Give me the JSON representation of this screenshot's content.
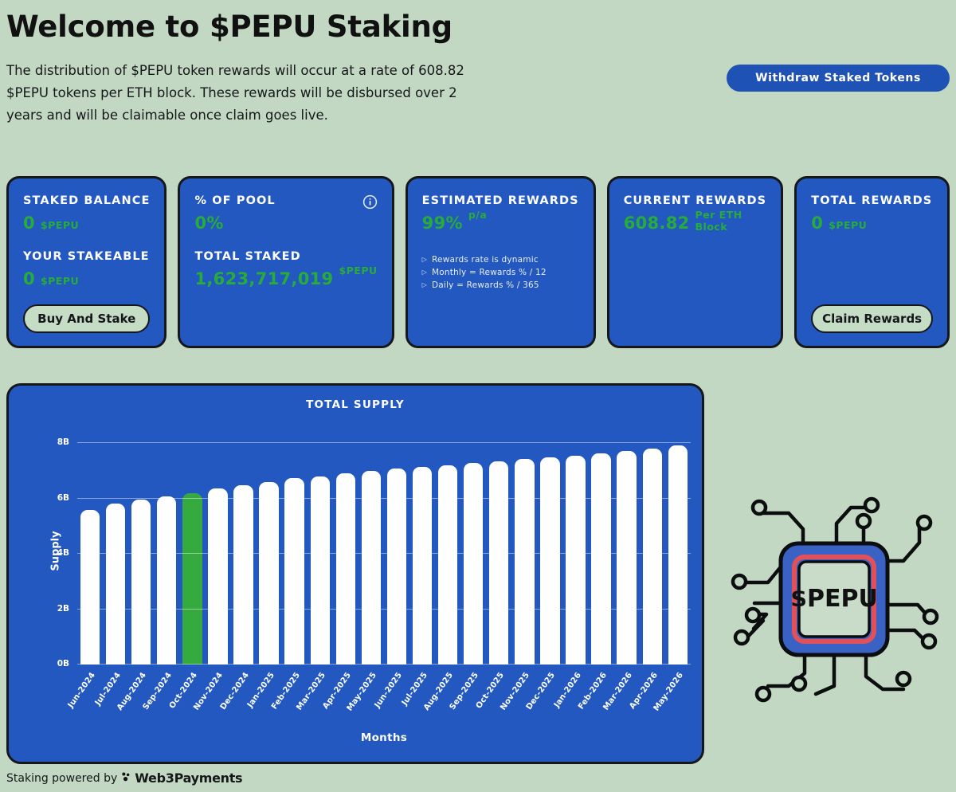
{
  "header": {
    "title": "Welcome to $PEPU Staking",
    "description": "The distribution of $PEPU token rewards will occur at a rate of 608.82 $PEPU tokens per ETH block. These rewards will be disbursed over 2 years and will be claimable once claim goes live.",
    "withdraw_button": "Withdraw Staked Tokens"
  },
  "cards": [
    {
      "label": "STAKED BALANCE",
      "value": "0",
      "unit": "$PEPU",
      "label2": "YOUR STAKEABLE",
      "value2": "0",
      "unit2": "$PEPU",
      "button": "Buy And Stake"
    },
    {
      "label": "% OF POOL",
      "value": "0%",
      "unit": "",
      "label2": "TOTAL STAKED",
      "value2": "1,623,717,019",
      "unit2": "$PEPU",
      "icon": "info-icon"
    },
    {
      "label": "ESTIMATED REWARDS",
      "value": "99%",
      "unit": "p/a",
      "bullets": [
        "Rewards rate is dynamic",
        "Monthly = Rewards % / 12",
        "Daily = Rewards % / 365"
      ]
    },
    {
      "label": "CURRENT REWARDS",
      "value": "608.82",
      "unit": "Per ETH Block"
    },
    {
      "label": "TOTAL REWARDS",
      "value": "0",
      "unit": "$PEPU",
      "button": "Claim Rewards"
    }
  ],
  "chip": {
    "label": "$PEPU",
    "body_color": "#3a62c4",
    "ring_color": "#e2515a"
  },
  "footer": {
    "text": "Staking powered by",
    "brand": "Web3Payments"
  },
  "colors": {
    "background": "#c2d8c2",
    "card_blue": "#2258bf",
    "accent_green": "#27ac3c",
    "highlight_bar": "#35aa3f",
    "outline": "#15171a"
  },
  "chart_data": {
    "type": "bar",
    "title": "TOTAL SUPPLY",
    "xlabel": "Months",
    "ylabel": "Supply",
    "ylim": [
      0,
      8
    ],
    "ytick_labels": [
      "0B",
      "2B",
      "4B",
      "6B",
      "8B"
    ],
    "ytick_values": [
      0,
      2,
      4,
      6,
      8
    ],
    "grid": true,
    "legend": "none",
    "highlight_index": 4,
    "categories": [
      "Jun-2024",
      "Jul-2024",
      "Aug-2024",
      "Sep-2024",
      "Oct-2024",
      "Nov-2024",
      "Dec-2024",
      "Jan-2025",
      "Feb-2025",
      "Mar-2025",
      "Apr-2025",
      "May-2025",
      "Jun-2025",
      "Jul-2025",
      "Aug-2025",
      "Sep-2025",
      "Oct-2025",
      "Nov-2025",
      "Dec-2025",
      "Jan-2026",
      "Feb-2026",
      "Mar-2026",
      "Apr-2026",
      "May-2026"
    ],
    "values": [
      5.58,
      5.82,
      5.96,
      6.08,
      6.2,
      6.35,
      6.48,
      6.6,
      6.72,
      6.8,
      6.9,
      6.98,
      7.07,
      7.13,
      7.2,
      7.28,
      7.34,
      7.42,
      7.48,
      7.55,
      7.62,
      7.7,
      7.8,
      7.9
    ]
  }
}
